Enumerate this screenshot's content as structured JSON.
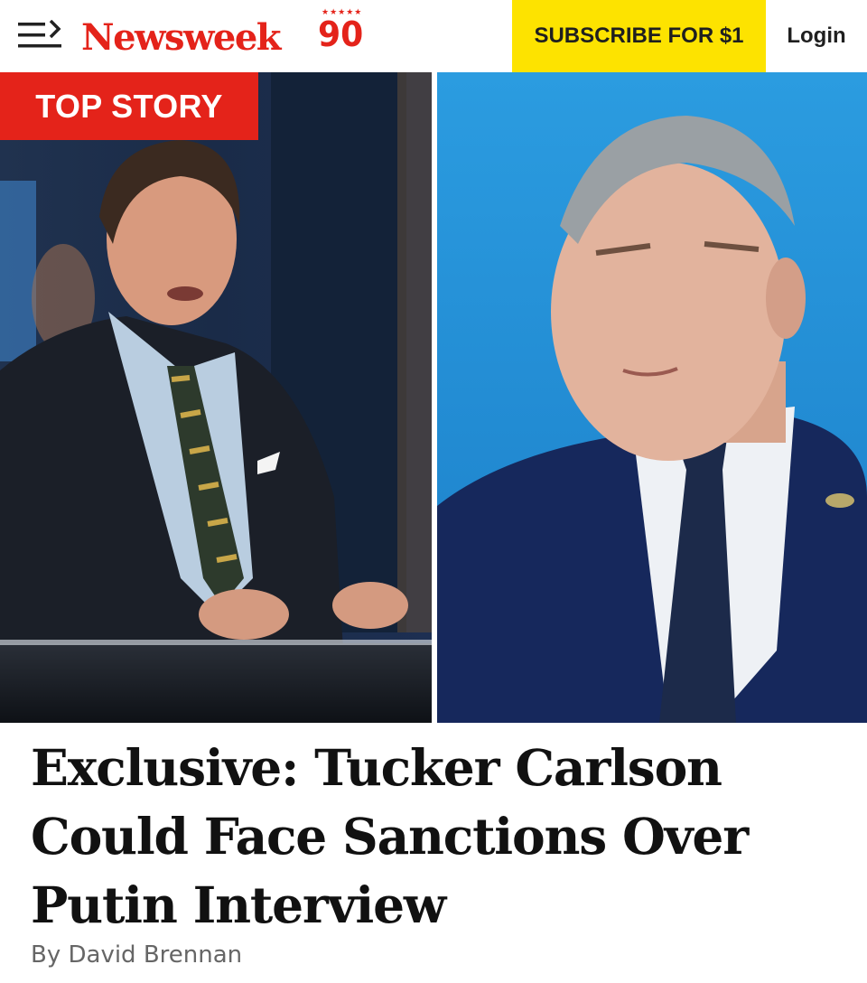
{
  "header": {
    "logo_text": "Newsweek",
    "logo_anniversary": "90",
    "logo_stars": "★★★★★",
    "subscribe_label": "SUBSCRIBE FOR $1",
    "login_label": "Login"
  },
  "hero": {
    "badge_label": "TOP STORY"
  },
  "article": {
    "headline": "Exclusive: Tucker Carlson Could Face Sanctions Over Putin Interview",
    "byline": "By David Brennan"
  },
  "colors": {
    "brand_red": "#e4231a",
    "subscribe_yellow": "#fde300"
  }
}
